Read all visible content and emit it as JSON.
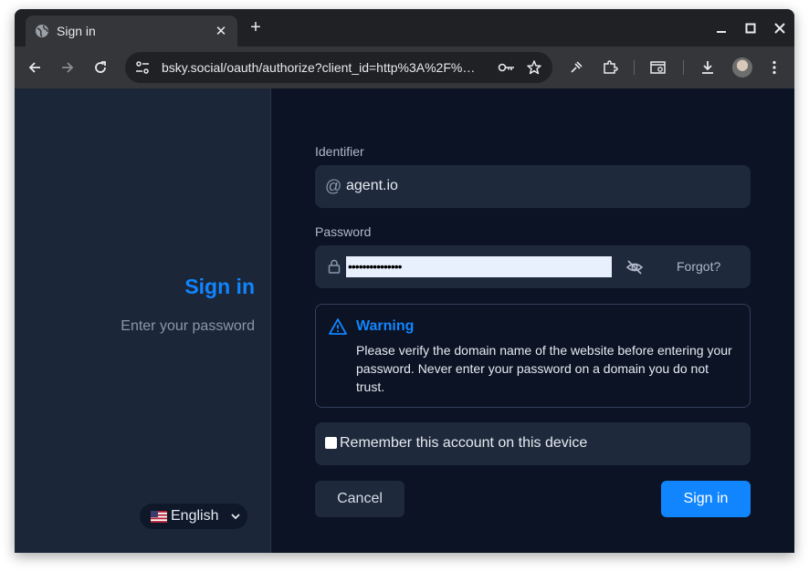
{
  "browser": {
    "tab_title": "Sign in",
    "tab_close": "✕",
    "new_tab": "+",
    "url": "bsky.social/oauth/authorize?client_id=http%3A%2F%…",
    "icons": [
      "globe-icon",
      "back-icon",
      "forward-icon",
      "reload-icon",
      "site-settings-icon",
      "password-key-icon",
      "bookmark-star-icon",
      "extension-pin-icon",
      "extensions-icon",
      "tab-search-icon",
      "downloads-icon",
      "profile-avatar",
      "menu-icon",
      "minimize-icon",
      "maximize-icon",
      "close-window-icon"
    ]
  },
  "left": {
    "title": "Sign in",
    "subtitle": "Enter your password",
    "language": "English"
  },
  "form": {
    "identifier_label": "Identifier",
    "identifier_prefix": "@",
    "identifier_value": "agent.io",
    "password_label": "Password",
    "password_masked": "•••••••••••••••",
    "forgot_label": "Forgot?",
    "warning_title": "Warning",
    "warning_text": "Please verify the domain name of the website before entering your password. Never enter your password on a domain you do not trust.",
    "remember_label": "Remember this account on this device",
    "cancel_label": "Cancel",
    "signin_label": "Sign in"
  },
  "colors": {
    "accent": "#1185fe",
    "page_bg": "#0b1324",
    "panel_bg": "#1b2638",
    "field_bg": "#1e293b"
  }
}
